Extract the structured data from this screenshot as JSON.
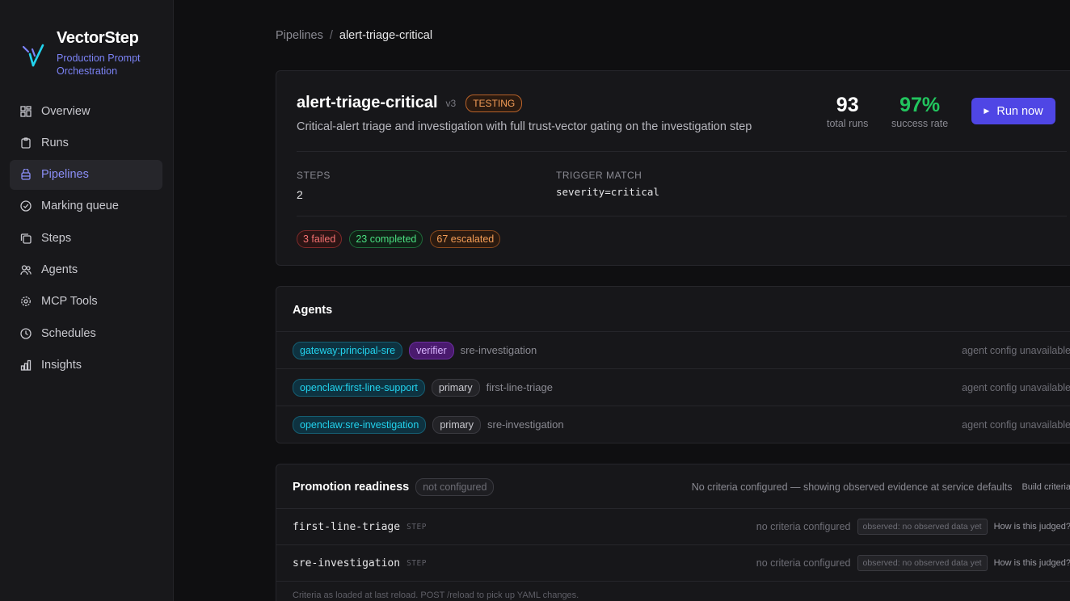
{
  "brand": {
    "name": "VectorStep",
    "tagline": "Production Prompt Orchestration"
  },
  "nav": [
    {
      "label": "Overview",
      "icon": "grid-icon"
    },
    {
      "label": "Runs",
      "icon": "clipboard-icon"
    },
    {
      "label": "Pipelines",
      "icon": "layers-icon",
      "active": true
    },
    {
      "label": "Marking queue",
      "icon": "check-circle-icon"
    },
    {
      "label": "Steps",
      "icon": "copy-icon"
    },
    {
      "label": "Agents",
      "icon": "users-icon"
    },
    {
      "label": "MCP Tools",
      "icon": "gear-icon"
    },
    {
      "label": "Schedules",
      "icon": "clock-icon"
    },
    {
      "label": "Insights",
      "icon": "bar-chart-icon"
    }
  ],
  "breadcrumb": {
    "parent": "Pipelines",
    "sep": "/",
    "current": "alert-triage-critical"
  },
  "pipeline": {
    "name": "alert-triage-critical",
    "version": "v3",
    "status": "TESTING",
    "description": "Critical-alert triage and investigation with full trust-vector gating on the investigation step",
    "total_runs": "93",
    "total_runs_label": "total runs",
    "success_rate": "97%",
    "success_rate_label": "success rate",
    "run_button": "Run now",
    "steps_label": "STEPS",
    "steps_value": "2",
    "trigger_label": "TRIGGER MATCH",
    "trigger_value": "severity=critical",
    "counts": {
      "failed": "3 failed",
      "completed": "23 completed",
      "escalated": "67 escalated"
    }
  },
  "agents": {
    "title": "Agents",
    "rows": [
      {
        "tag": "gateway:principal-sre",
        "role": "verifier",
        "step": "sre-investigation",
        "status": "agent config unavailable"
      },
      {
        "tag": "openclaw:first-line-support",
        "role": "primary",
        "step": "first-line-triage",
        "status": "agent config unavailable"
      },
      {
        "tag": "openclaw:sre-investigation",
        "role": "primary",
        "step": "sre-investigation",
        "status": "agent config unavailable"
      }
    ]
  },
  "promotion": {
    "title": "Promotion readiness",
    "badge": "not configured",
    "hint": "No criteria configured — showing observed evidence at service defaults",
    "build_link": "Build criteria",
    "rows": [
      {
        "name": "first-line-triage",
        "tag": "STEP",
        "criteria": "no criteria configured",
        "observed": "observed: no observed data yet",
        "link": "How is this judged?"
      },
      {
        "name": "sre-investigation",
        "tag": "STEP",
        "criteria": "no criteria configured",
        "observed": "observed: no observed data yet",
        "link": "How is this judged?"
      }
    ],
    "footnote": "Criteria as loaded at last reload. POST /reload to pick up YAML changes."
  },
  "colors": {
    "accent": "#4f46e5",
    "success": "#22c55e",
    "link": "#7c83f7"
  }
}
